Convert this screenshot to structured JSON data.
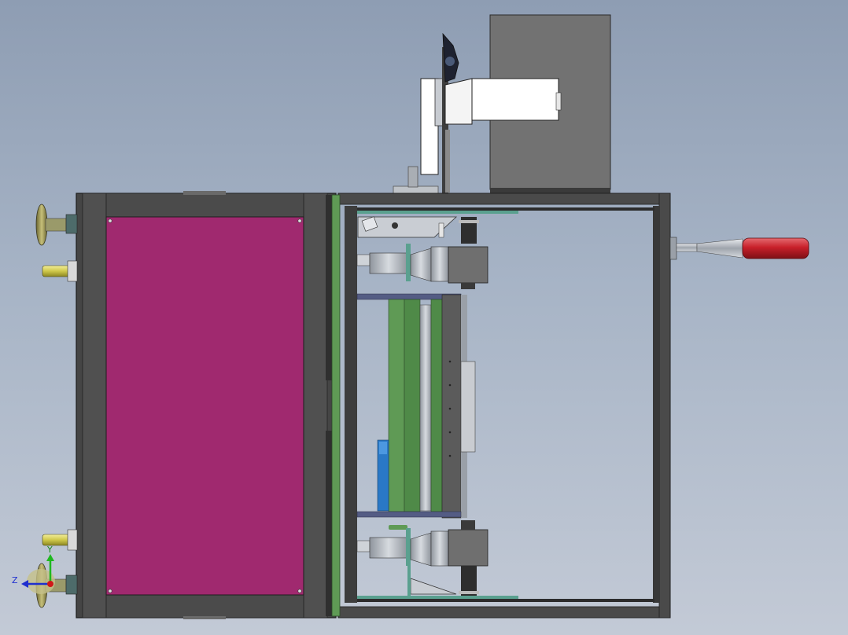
{
  "app": {
    "view": "cad-model-viewport"
  },
  "triad": {
    "z_label": "Z",
    "y_label": "Y",
    "colors": {
      "z_axis": "#1f2fcf",
      "y_axis": "#1fb81f",
      "origin": "#d01818"
    }
  },
  "model": {
    "colors": {
      "frame_dark": "#474747",
      "frame_light": "#5c5c5c",
      "door_panel": "#a0296f",
      "green_plate": "#5f9a55",
      "handle_grip": "#c8202a",
      "handle_metal": "#aeb4bc",
      "motor_box": "#6f6f6f",
      "blue_part": "#2a78c6",
      "lamp_yellow": "#cfc84a"
    },
    "icons": [
      "leveling-foot-icon",
      "caster-icon",
      "handle-icon",
      "motor-icon",
      "lens-assembly-icon"
    ]
  }
}
